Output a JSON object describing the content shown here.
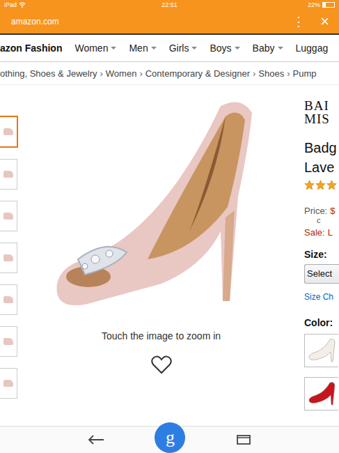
{
  "status_bar": {
    "device": "iPad",
    "time": "22:51",
    "battery": "22%",
    "battery_level": 0.22
  },
  "browser": {
    "url": "amazon.com",
    "menu": "⋮",
    "close": "×"
  },
  "nav": {
    "brand": "azon Fashion",
    "items": [
      {
        "label": "Women",
        "dropdown": true
      },
      {
        "label": "Men",
        "dropdown": true
      },
      {
        "label": "Girls",
        "dropdown": true
      },
      {
        "label": "Boys",
        "dropdown": true
      },
      {
        "label": "Baby",
        "dropdown": true
      },
      {
        "label": "Luggag",
        "dropdown": false
      }
    ]
  },
  "breadcrumb": {
    "separator": "›",
    "items": [
      "othing, Shoes & Jewelry",
      "Women",
      "Contemporary & Designer",
      "Shoes",
      "Pump"
    ]
  },
  "gallery": {
    "thumbnails": [
      {
        "selected": true
      },
      {
        "selected": false
      },
      {
        "selected": false
      },
      {
        "selected": false
      },
      {
        "selected": false
      },
      {
        "selected": false
      },
      {
        "selected": false
      }
    ],
    "zoom_hint": "Touch the image to zoom in",
    "favorite": false
  },
  "product": {
    "brand_logo": [
      "BAI",
      "MIS"
    ],
    "title": [
      "Badg",
      "Lave"
    ],
    "stars": 3,
    "price_label": "Price:",
    "price": "$",
    "price_note": "c",
    "sale_label": "Sale:",
    "sale_price": "L",
    "size_label": "Size:",
    "size_select": "Select",
    "size_chart": "Size Ch",
    "color_label": "Color:",
    "colors": [
      {
        "selected": false,
        "color": "#f3efe8"
      },
      {
        "selected": false,
        "color": "#c4161c"
      }
    ]
  },
  "bottom_bar": {
    "search": "g"
  }
}
